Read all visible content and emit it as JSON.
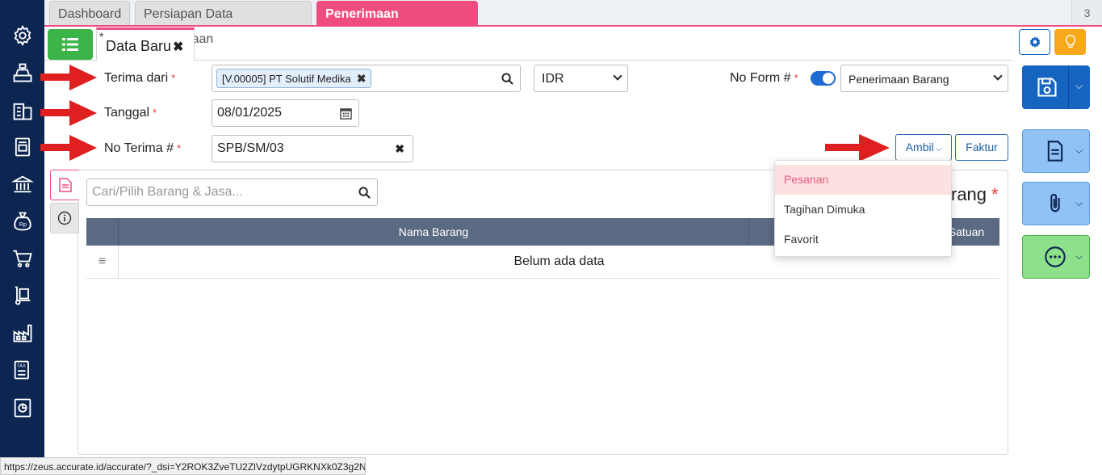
{
  "tabs": [
    {
      "label": "Dashboard"
    },
    {
      "label": "Persiapan Data Perusahaan"
    },
    {
      "label": "Penerimaan Barang",
      "close": "✖"
    }
  ],
  "tab_count": "3",
  "subtab": {
    "modified_marker": "*",
    "label": "Data Baru",
    "close": "✖"
  },
  "form": {
    "terima_dari_label": "Terima dari",
    "terima_dari_value": "[V.00005] PT Solutif Medika",
    "currency": "IDR",
    "no_form_label": "No Form #",
    "no_form_value": "Penerimaan Barang",
    "tanggal_label": "Tanggal",
    "tanggal_value": "08/01/2025",
    "no_terima_label": "No Terima #",
    "no_terima_value": "SPB/SM/03",
    "required_marker": "*"
  },
  "buttons": {
    "ambil": "Ambil",
    "faktur": "Faktur"
  },
  "ambil_menu": [
    "Pesanan",
    "Tagihan Dimuka",
    "Favorit"
  ],
  "panel": {
    "search_placeholder": "Cari/Pilih Barang & Jasa...",
    "partial_heading": "rang",
    "columns": [
      "Nama Barang",
      "Satuan"
    ],
    "empty_text": "Belum ada data"
  },
  "status_url": "https://zeus.accurate.id/accurate/?_dsi=Y2ROK3ZveTU2ZlVzdytpUGRKNXk0Z3g2N...",
  "colors": {
    "sidebar": "#0c2551",
    "accent_pink": "#ef4d80",
    "primary_blue": "#1565c0",
    "light_blue": "#90c2f5",
    "green": "#3bb44a",
    "arrow_red": "#e02020"
  },
  "sidebar_icons": [
    "gear-icon",
    "cashier-icon",
    "building-icon",
    "book-icon",
    "bank-icon",
    "money-bag-icon",
    "cart-icon",
    "hand-truck-icon",
    "factory-icon",
    "tax-icon",
    "report-icon"
  ]
}
